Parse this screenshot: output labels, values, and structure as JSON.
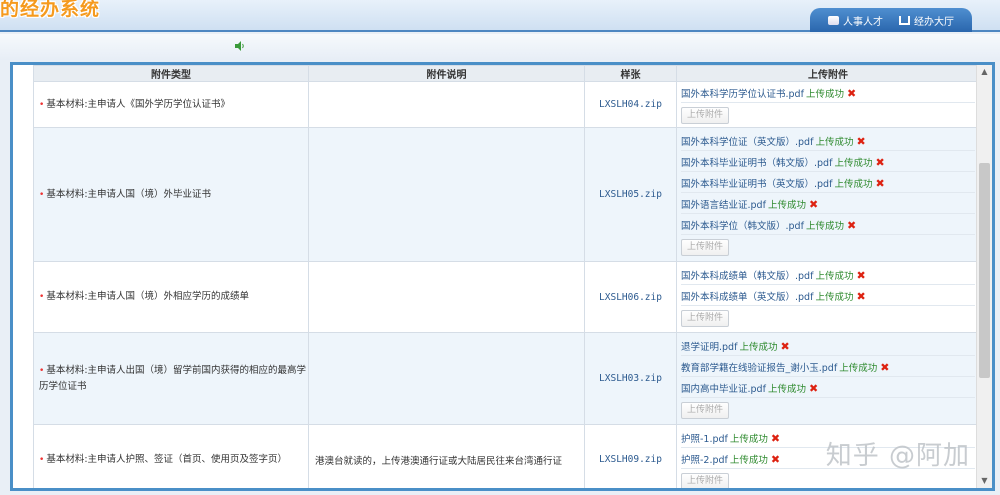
{
  "header": {
    "system_title": "的经办系统",
    "tabs": [
      {
        "label": "人事人才"
      },
      {
        "label": "经办大厅"
      }
    ]
  },
  "table": {
    "columns": [
      "附件类型",
      "附件说明",
      "样张",
      "上传附件"
    ],
    "upload_button_label": "上传附件",
    "success_label": "上传成功",
    "rows": [
      {
        "type": "基本材料:主申请人《国外学历学位认证书》",
        "description": "",
        "sample": "LXSLH04.zip",
        "files": [
          "国外本科学历学位认证书.pdf"
        ]
      },
      {
        "type": "基本材料:主申请人国（境）外毕业证书",
        "description": "",
        "sample": "LXSLH05.zip",
        "files": [
          "国外本科学位证（英文版）.pdf",
          "国外本科毕业证明书（韩文版）.pdf",
          "国外本科毕业证明书（英文版）.pdf",
          "国外语言结业证.pdf",
          "国外本科学位（韩文版）.pdf"
        ]
      },
      {
        "type": "基本材料:主申请人国（境）外相应学历的成绩单",
        "description": "",
        "sample": "LXSLH06.zip",
        "files": [
          "国外本科成绩单（韩文版）.pdf",
          "国外本科成绩单（英文版）.pdf"
        ]
      },
      {
        "type": "基本材料:主申请人出国（境）留学前国内获得的相应的最高学历学位证书",
        "description": "",
        "sample": "LXSLH03.zip",
        "files": [
          "退学证明.pdf",
          "教育部学籍在线验证报告_谢小玉.pdf",
          "国内高中毕业证.pdf"
        ]
      },
      {
        "type": "基本材料:主申请人护照、签证（首页、使用页及签字页）",
        "description": "港澳台就读的，上传港澳通行证或大陆居民往来台湾通行证",
        "sample": "LXSLH09.zip",
        "files": [
          "护照-1.pdf",
          "护照-2.pdf"
        ]
      }
    ]
  },
  "watermark": "知乎 @阿加",
  "colors": {
    "accent": "#4a8fc7",
    "title_orange": "#f59a1e",
    "success_green": "#2e8a2e",
    "delete_red": "#d21111",
    "link_blue": "#2c5a8f"
  }
}
